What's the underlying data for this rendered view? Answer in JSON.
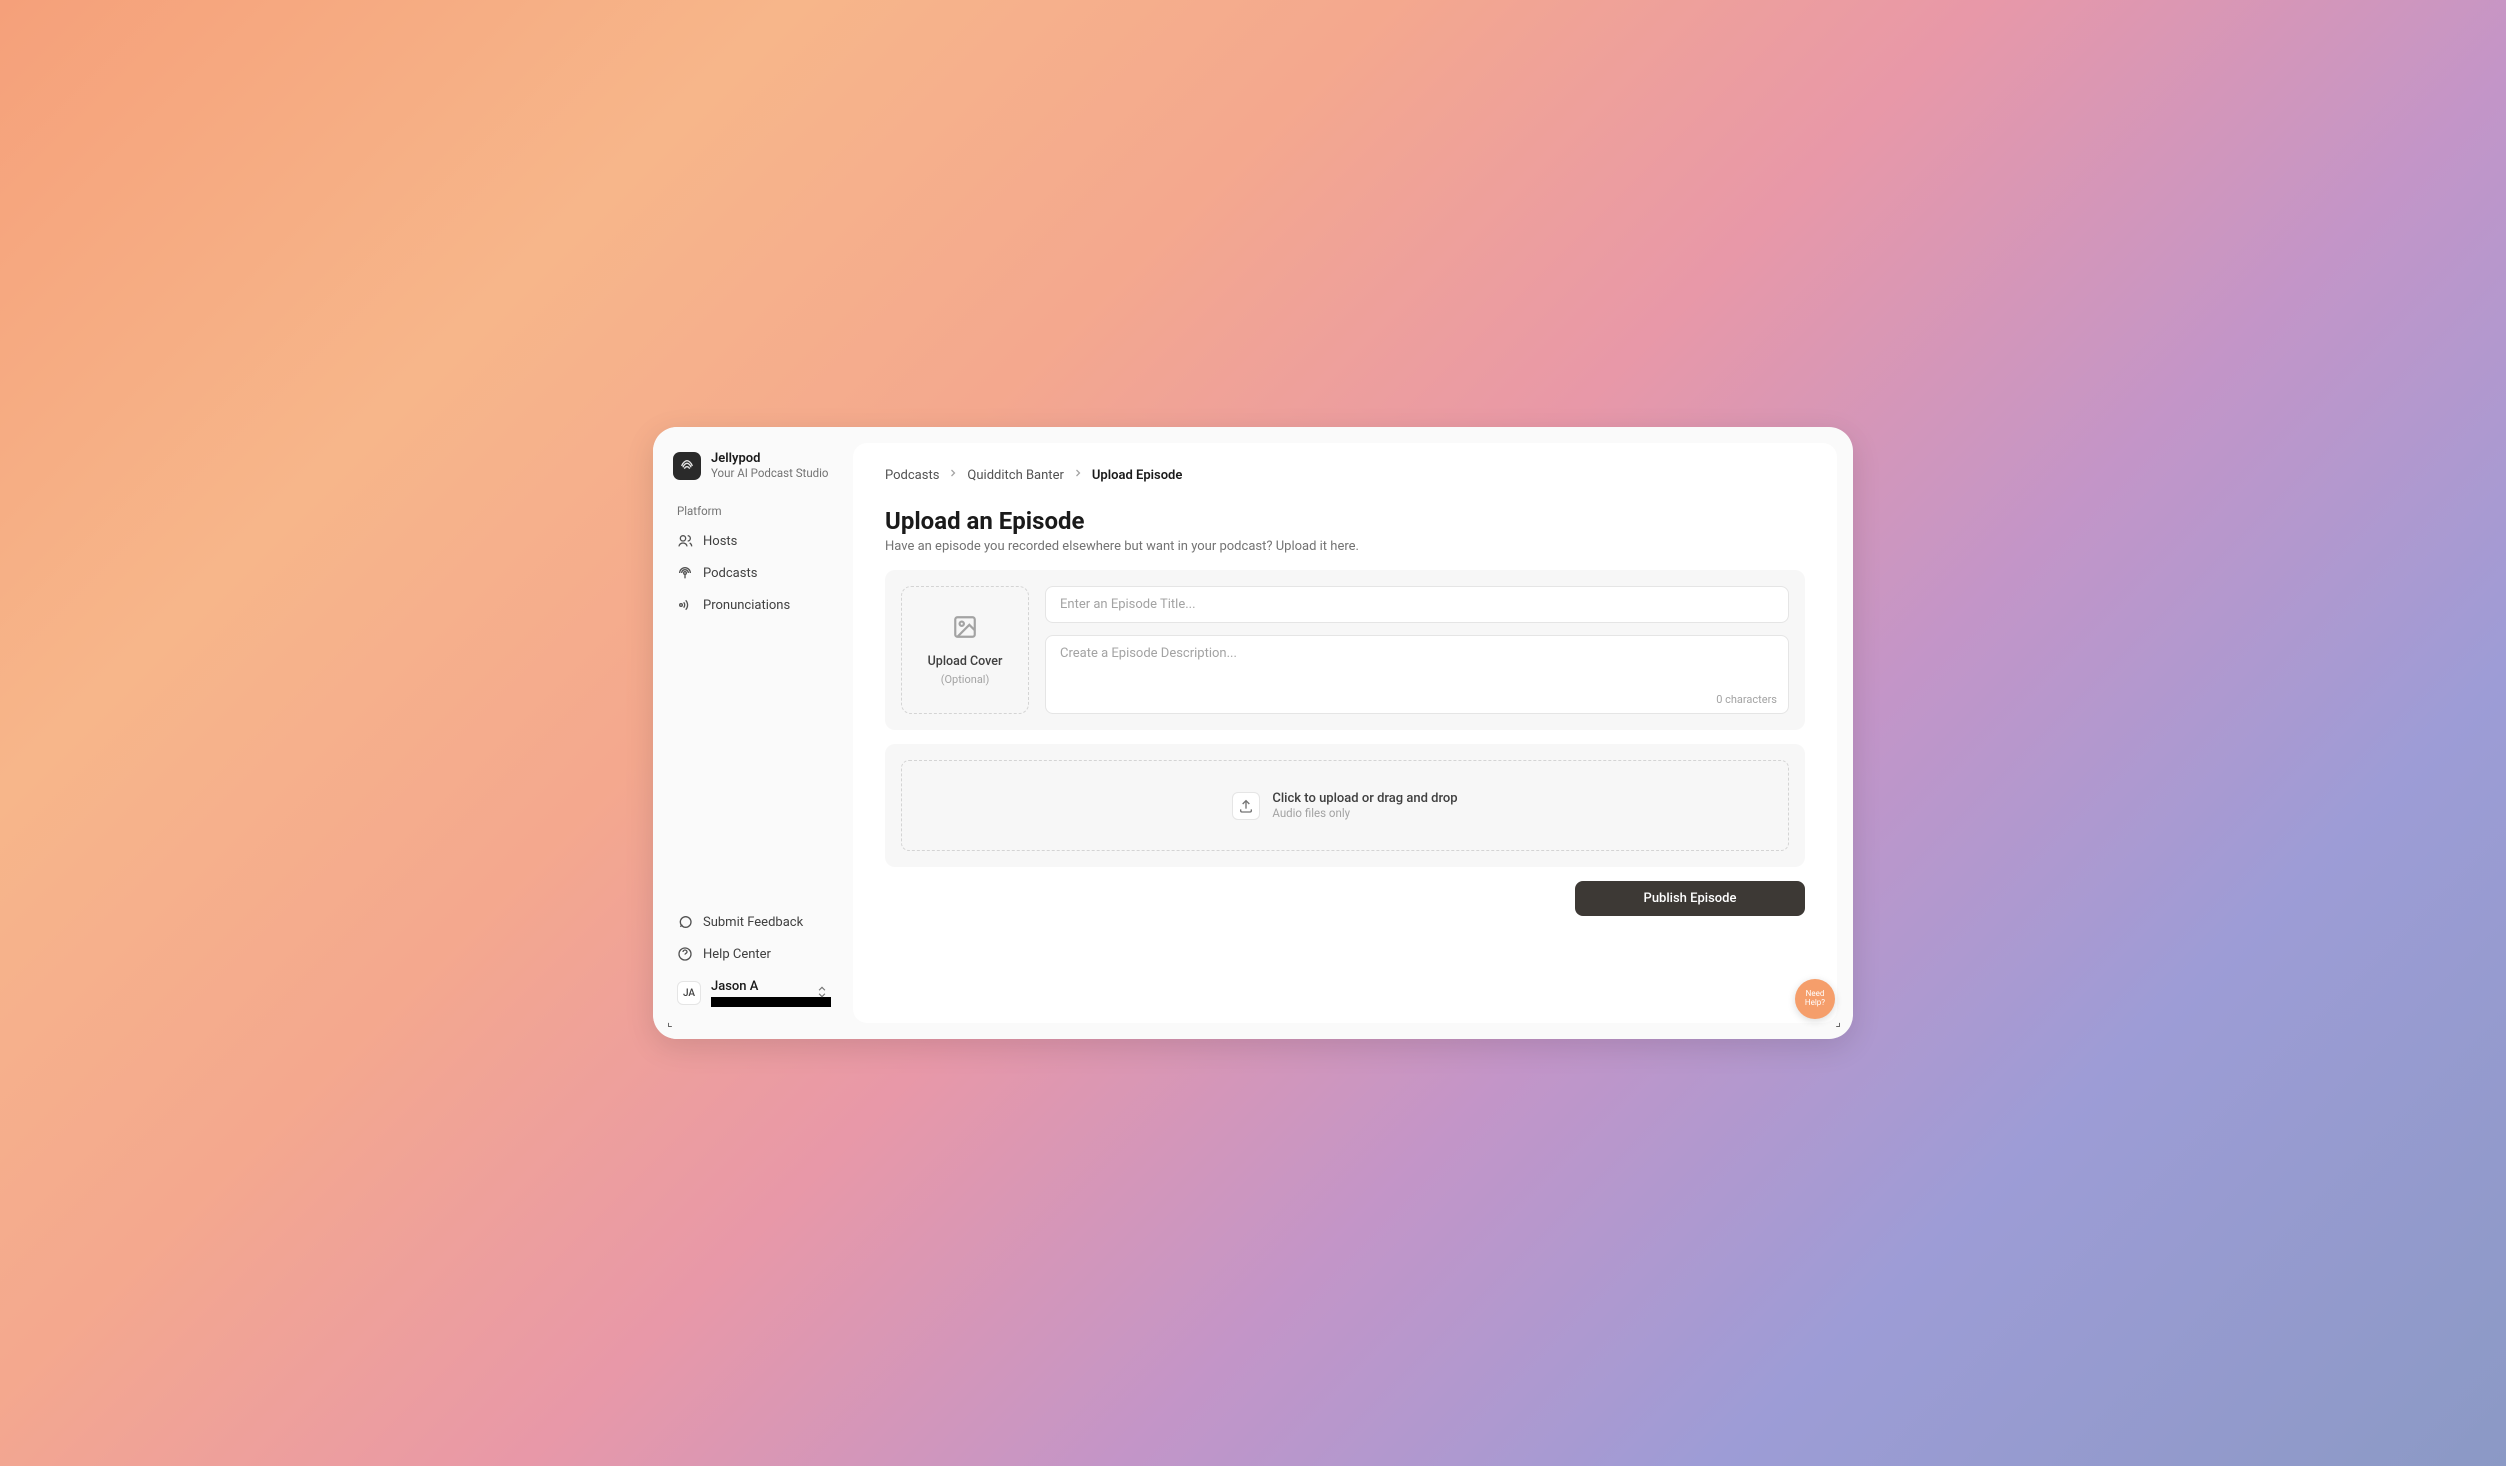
{
  "brand": {
    "name": "Jellypod",
    "tagline": "Your AI Podcast Studio"
  },
  "sidebar": {
    "section_label": "Platform",
    "items": [
      {
        "label": "Hosts"
      },
      {
        "label": "Podcasts"
      },
      {
        "label": "Pronunciations"
      }
    ],
    "footer": {
      "feedback": "Submit Feedback",
      "help": "Help Center"
    },
    "user": {
      "initials": "JA",
      "name": "Jason A"
    }
  },
  "breadcrumb": {
    "level1": "Podcasts",
    "level2": "Quidditch Banter",
    "current": "Upload Episode"
  },
  "page": {
    "title": "Upload an Episode",
    "subtitle": "Have an episode you recorded elsewhere but want in your podcast? Upload it here."
  },
  "form": {
    "cover": {
      "label": "Upload Cover",
      "optional": "(Optional)"
    },
    "title_placeholder": "Enter an Episode Title...",
    "desc_placeholder": "Create a Episode Description...",
    "char_count": "0 characters"
  },
  "dropzone": {
    "title": "Click to upload or drag and drop",
    "sub": "Audio files only"
  },
  "actions": {
    "publish": "Publish Episode"
  },
  "fab": {
    "label": "Need Help?"
  }
}
